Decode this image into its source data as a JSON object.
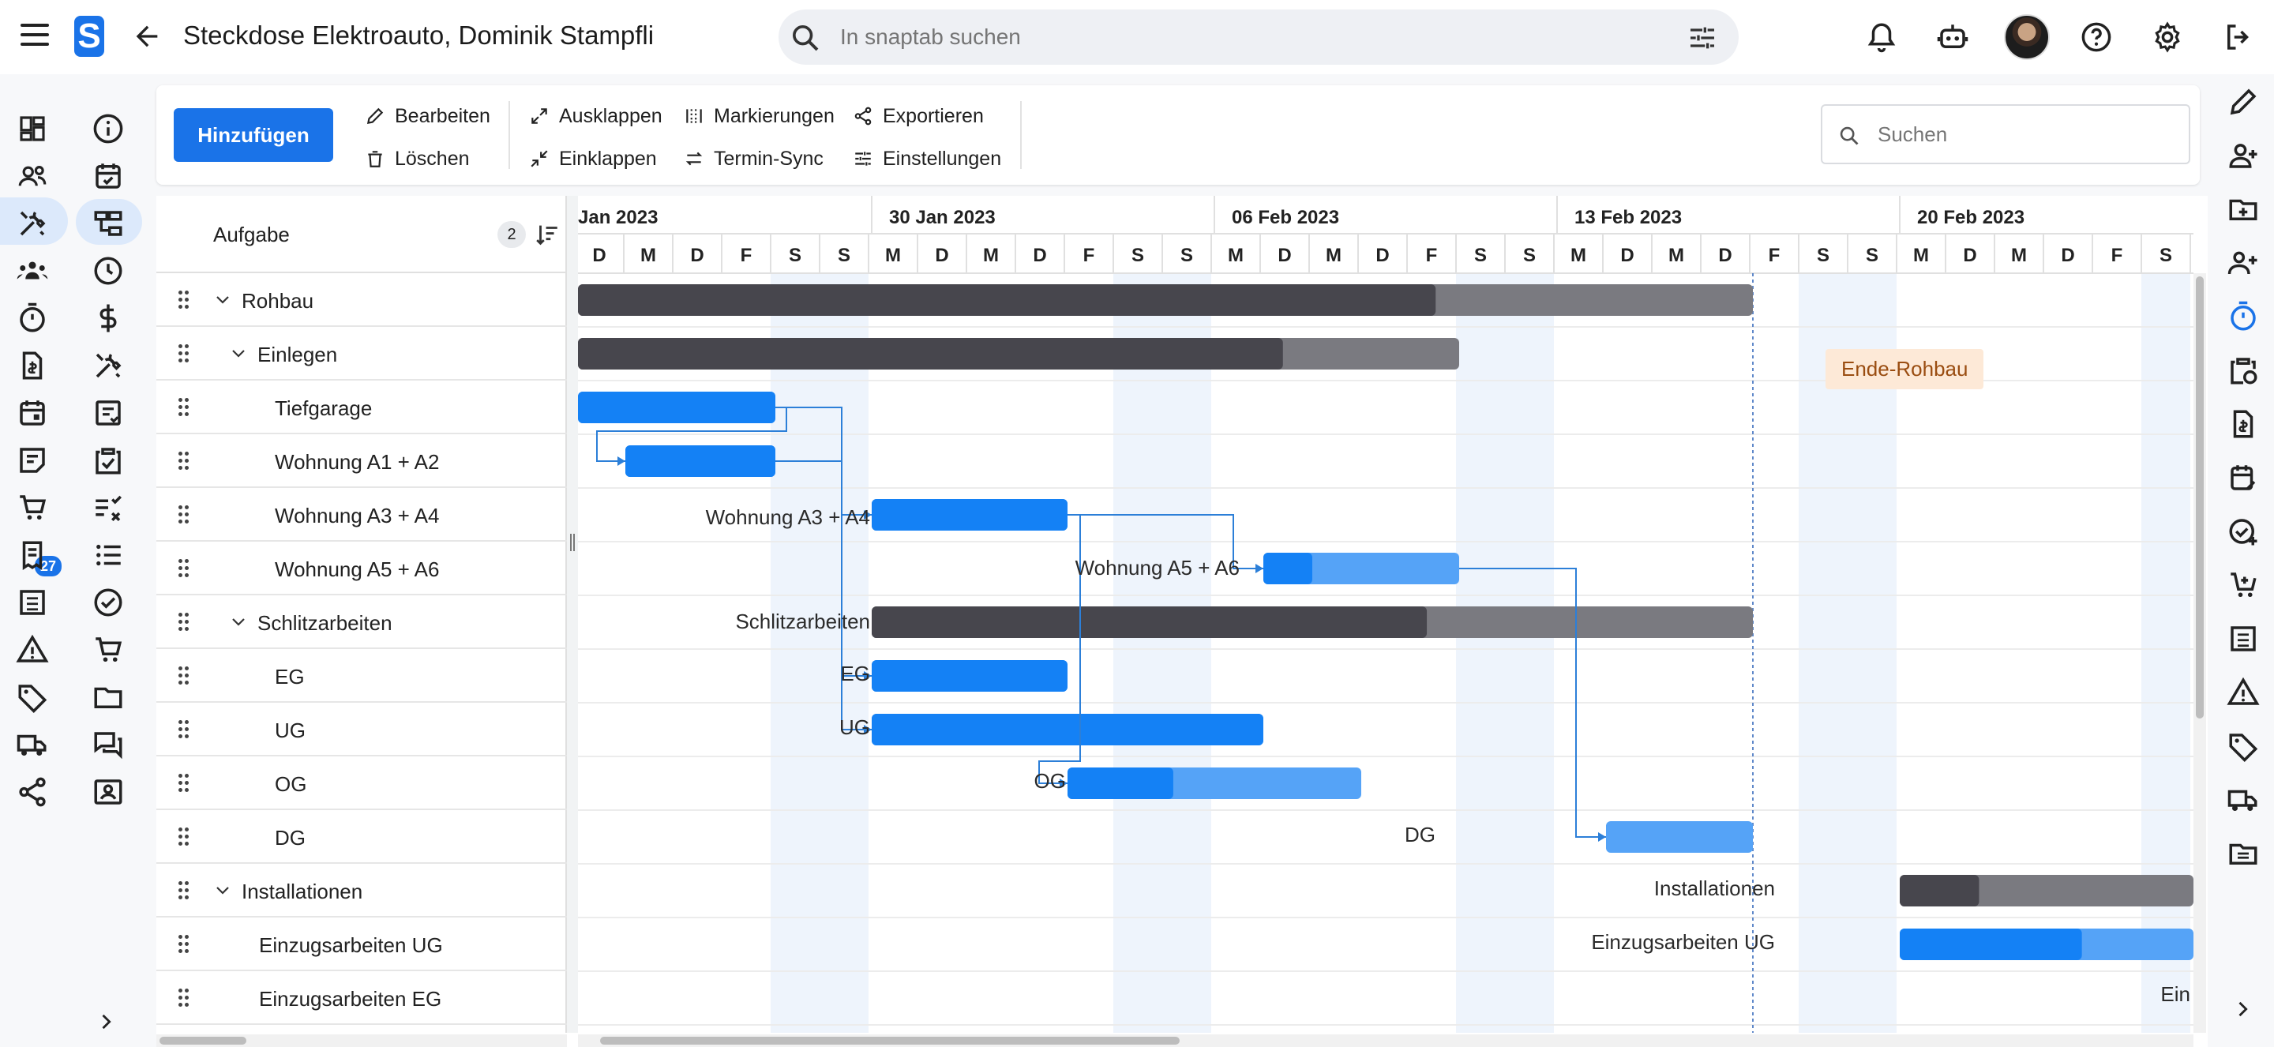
{
  "app": {
    "logo_letter": "S",
    "title": "Steckdose Elektroauto, Dominik Stampfli",
    "search_placeholder": "In snaptab suchen",
    "cart_badge": "27",
    "accent": "#1a73e8"
  },
  "toolbar": {
    "add_label": "Hinzufügen",
    "edit_label": "Bearbeiten",
    "delete_label": "Löschen",
    "expand_label": "Ausklappen",
    "collapse_label": "Einklappen",
    "markers_label": "Markierungen",
    "sync_label": "Termin-Sync",
    "export_label": "Exportieren",
    "settings_label": "Einstellungen",
    "search_placeholder": "Suchen"
  },
  "grid": {
    "column_title": "Aufgabe",
    "sort_count": "2",
    "rows": [
      {
        "label": "Rohbau",
        "level": 0,
        "parent": true
      },
      {
        "label": "Einlegen",
        "level": 1,
        "parent": true
      },
      {
        "label": "Tiefgarage",
        "level": 2,
        "parent": false
      },
      {
        "label": "Wohnung A1 + A2",
        "level": 2,
        "parent": false
      },
      {
        "label": "Wohnung A3 + A4",
        "level": 2,
        "parent": false
      },
      {
        "label": "Wohnung A5 + A6",
        "level": 2,
        "parent": false
      },
      {
        "label": "Schlitzarbeiten",
        "level": 1,
        "parent": true
      },
      {
        "label": "EG",
        "level": 2,
        "parent": false
      },
      {
        "label": "UG",
        "level": 2,
        "parent": false
      },
      {
        "label": "OG",
        "level": 2,
        "parent": false
      },
      {
        "label": "DG",
        "level": 2,
        "parent": false
      },
      {
        "label": "Installationen",
        "level": 0,
        "parent": true
      },
      {
        "label": "Einzugsarbeiten UG",
        "level": 1,
        "parent": false
      },
      {
        "label": "Einzugsarbeiten EG",
        "level": 1,
        "parent": false
      }
    ]
  },
  "timeline": {
    "months": [
      "Jan 2023",
      "30 Jan 2023",
      "06 Feb 2023",
      "13 Feb 2023",
      "20 Feb 2023"
    ],
    "days": [
      "D",
      "M",
      "D",
      "F",
      "S",
      "S",
      "M",
      "D",
      "M",
      "D",
      "F",
      "S",
      "S",
      "M",
      "D",
      "M",
      "D",
      "F",
      "S",
      "S",
      "M",
      "D",
      "M",
      "D",
      "F",
      "S",
      "S",
      "M",
      "D",
      "M",
      "D",
      "F",
      "S"
    ],
    "milestone": "Ende-Rohbau",
    "bar_labels": {
      "a34": "Wohnung A3 + A4",
      "a56": "Wohnung A5 + A6",
      "schlitz": "Schlitzarbeiten",
      "eg": "EG",
      "ug": "UG",
      "og": "OG",
      "dg": "DG",
      "inst": "Installationen",
      "einzug_ug": "Einzugsarbeiten UG",
      "einzug_eg": "Ein"
    }
  }
}
